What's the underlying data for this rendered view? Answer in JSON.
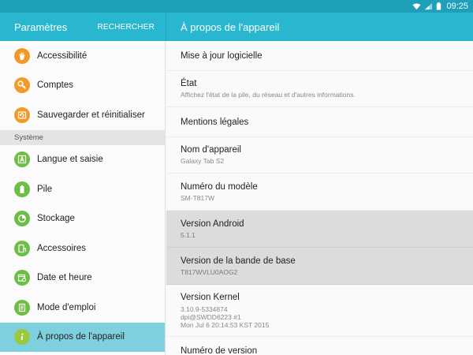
{
  "status_bar": {
    "time": "09:25"
  },
  "left_header": {
    "title": "Paramètres",
    "search_label": "RECHERCHER"
  },
  "right_header": {
    "title": "À propos de l'appareil"
  },
  "left_items_top": [
    {
      "label": "Accessibilité",
      "icon": "hand-icon"
    },
    {
      "label": "Comptes",
      "icon": "key-icon"
    },
    {
      "label": "Sauvegarder et réinitialiser",
      "icon": "backup-icon"
    }
  ],
  "left_section": {
    "label": "Système"
  },
  "left_items_system": [
    {
      "label": "Langue et saisie",
      "icon": "language-icon"
    },
    {
      "label": "Pile",
      "icon": "battery-icon"
    },
    {
      "label": "Stockage",
      "icon": "storage-icon"
    },
    {
      "label": "Accessoires",
      "icon": "accessories-icon"
    },
    {
      "label": "Date et heure",
      "icon": "calendar-icon"
    },
    {
      "label": "Mode d'emploi",
      "icon": "manual-icon"
    },
    {
      "label": "À propos de l'appareil",
      "icon": "info-icon"
    }
  ],
  "right_items": [
    {
      "title": "Mise à jour logicielle",
      "subtitle": ""
    },
    {
      "title": "État",
      "subtitle": "Affichez l'état de la pile, du réseau et d'autres informations."
    },
    {
      "title": "Mentions légales",
      "subtitle": ""
    },
    {
      "title": "Nom d'appareil",
      "subtitle": "Galaxy Tab S2"
    },
    {
      "title": "Numéro du modèle",
      "subtitle": "SM-T817W"
    },
    {
      "title": "Version Android",
      "subtitle": "5.1.1"
    },
    {
      "title": "Version de la bande de base",
      "subtitle": "T817WVLU0AOG2"
    },
    {
      "title": "Version Kernel",
      "subtitle_lines": [
        "3.10.9-5334874",
        "dpi@SWDD6223 #1",
        "Mon Jul 6 20:14:53 KST 2015"
      ]
    },
    {
      "title": "Numéro de version",
      "subtitle": ""
    }
  ],
  "colors": {
    "status_bar": "#1e9fba",
    "header": "#29b6cf",
    "active_item": "#7fd0df",
    "highlight_row": "#dcdcdc",
    "icon_orange": "#f19a2a",
    "icon_green": "#6cbe45"
  }
}
